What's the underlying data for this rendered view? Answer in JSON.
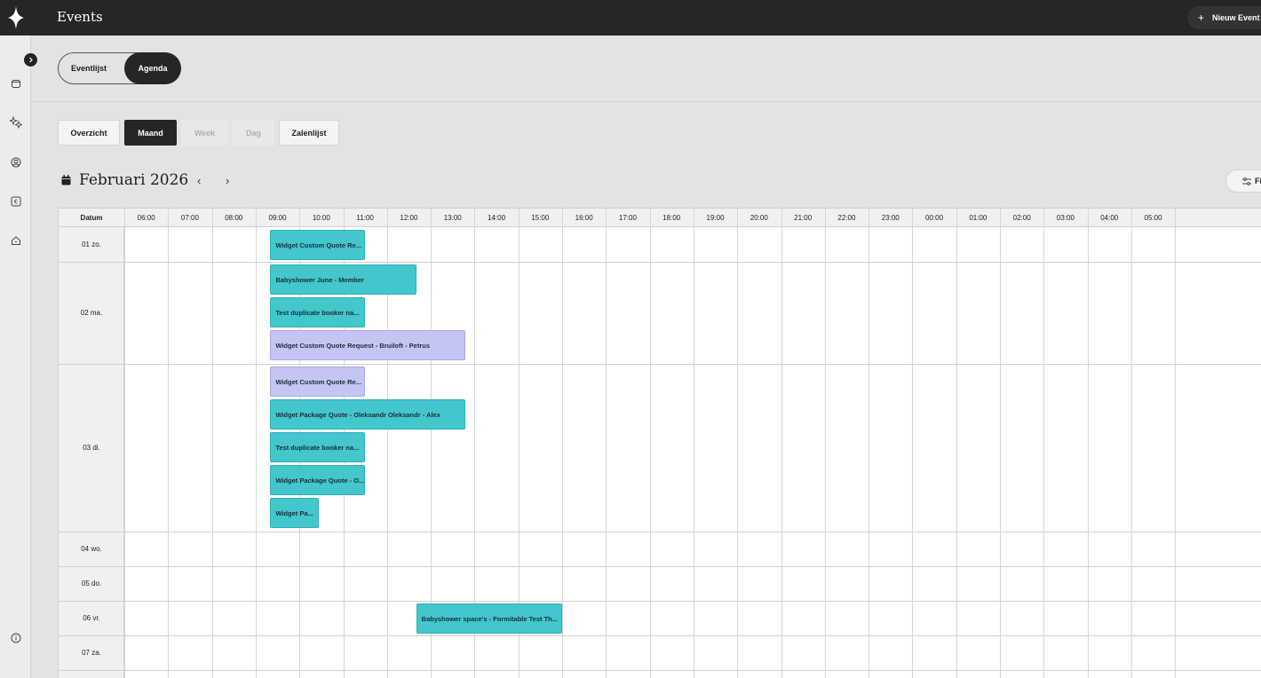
{
  "app": {
    "page_title": "Events",
    "new_event_label": "Nieuw Event"
  },
  "view_toggle": {
    "list_label": "Eventlijst",
    "agenda_label": "Agenda",
    "active": "Agenda"
  },
  "range_buttons": {
    "overzicht": "Overzicht",
    "maand": "Maand",
    "week": "Week",
    "dag": "Dag",
    "zalenlijst": "Zalenlijst",
    "active": "Maand"
  },
  "calendar": {
    "month_title": "Februari 2026",
    "filter_label": "Fi",
    "date_header": "Datum",
    "hours": [
      "06:00",
      "07:00",
      "08:00",
      "09:00",
      "10:00",
      "11:00",
      "12:00",
      "13:00",
      "14:00",
      "15:00",
      "16:00",
      "17:00",
      "18:00",
      "19:00",
      "20:00",
      "21:00",
      "22:00",
      "23:00",
      "00:00",
      "01:00",
      "02:00",
      "03:00",
      "04:00",
      "05:00"
    ],
    "days": [
      {
        "label": "01 zo.",
        "events": [
          {
            "title": "Widget Custom Quote Re...",
            "start": "09:20",
            "end": "11:30",
            "color": "teal"
          }
        ]
      },
      {
        "label": "02 ma.",
        "events": [
          {
            "title": "Babyshower June - Member",
            "start": "09:20",
            "end": "12:40",
            "color": "teal"
          },
          {
            "title": "Test duplicate booker na...",
            "start": "09:20",
            "end": "11:30",
            "color": "teal"
          },
          {
            "title": "Widget Custom Quote Request - Bruiloft - Petrus",
            "start": "09:20",
            "end": "13:47",
            "color": "lavender"
          }
        ]
      },
      {
        "label": "03 di.",
        "events": [
          {
            "title": "Widget Custom Quote Re...",
            "start": "09:20",
            "end": "11:30",
            "color": "lavender"
          },
          {
            "title": "Widget Package Quote - Oleksandr Oleksandr - Alex",
            "start": "09:20",
            "end": "13:47",
            "color": "teal"
          },
          {
            "title": "Test duplicate booker na...",
            "start": "09:20",
            "end": "11:30",
            "color": "teal"
          },
          {
            "title": "Widget Package Quote - O...",
            "start": "09:20",
            "end": "11:30",
            "color": "teal"
          },
          {
            "title": "Widget Pa...",
            "start": "09:20",
            "end": "10:26",
            "color": "teal"
          }
        ]
      },
      {
        "label": "04 wo.",
        "events": []
      },
      {
        "label": "05 do.",
        "events": []
      },
      {
        "label": "06 vr.",
        "events": [
          {
            "title": "Babyshower space's - Formitable Test Th...",
            "start": "12:40",
            "end": "16:00",
            "color": "teal"
          }
        ]
      },
      {
        "label": "07 za.",
        "events": []
      }
    ]
  },
  "colors": {
    "topbar": "#262626",
    "teal_event": "#43c6cc",
    "lavender_event": "#c5c5f5",
    "grid_line": "#d6d6d6"
  },
  "icons": [
    "logo-diamond-icon",
    "expand-chevron-icon",
    "cube-icon",
    "magic-sparkle-icon",
    "user-circle-icon",
    "euro-icon",
    "home-icon",
    "info-icon",
    "calendar-icon",
    "chevron-left-icon",
    "chevron-right-icon",
    "plus-icon",
    "filter-sliders-icon"
  ]
}
